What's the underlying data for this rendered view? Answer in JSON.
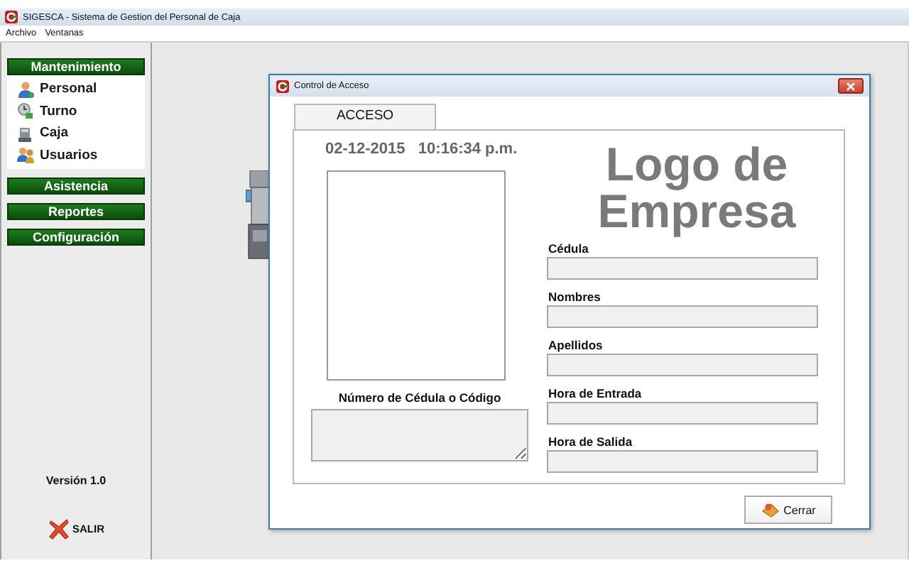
{
  "window": {
    "title": "SIGESCA - Sistema de Gestion del Personal de Caja"
  },
  "menu": [
    "Archivo",
    "Ventanas"
  ],
  "sidebar": {
    "sections": [
      {
        "label": "Mantenimiento",
        "expanded": true,
        "items": [
          "Personal",
          "Turno",
          "Caja",
          "Usuarios"
        ]
      },
      {
        "label": "Asistencia",
        "expanded": false
      },
      {
        "label": "Reportes",
        "expanded": false
      },
      {
        "label": "Configuración",
        "expanded": false
      }
    ],
    "version": "Versión  1.0",
    "exit_button": "SALIR"
  },
  "dialog": {
    "title": "Control de Acceso",
    "tabs": [
      {
        "label": "ACCESO",
        "selected": true
      }
    ],
    "datetime": "02-12-2015   10:16:34 p.m.",
    "logo_lines": [
      "Logo de",
      "Empresa"
    ],
    "code_label": "Número de Cédula o Código",
    "fields": [
      {
        "label": "Cédula"
      },
      {
        "label": "Nombres"
      },
      {
        "label": "Apellidos"
      },
      {
        "label": "Hora de Entrada"
      },
      {
        "label": "Hora de Salida"
      }
    ],
    "close_button": "Cerrar"
  }
}
